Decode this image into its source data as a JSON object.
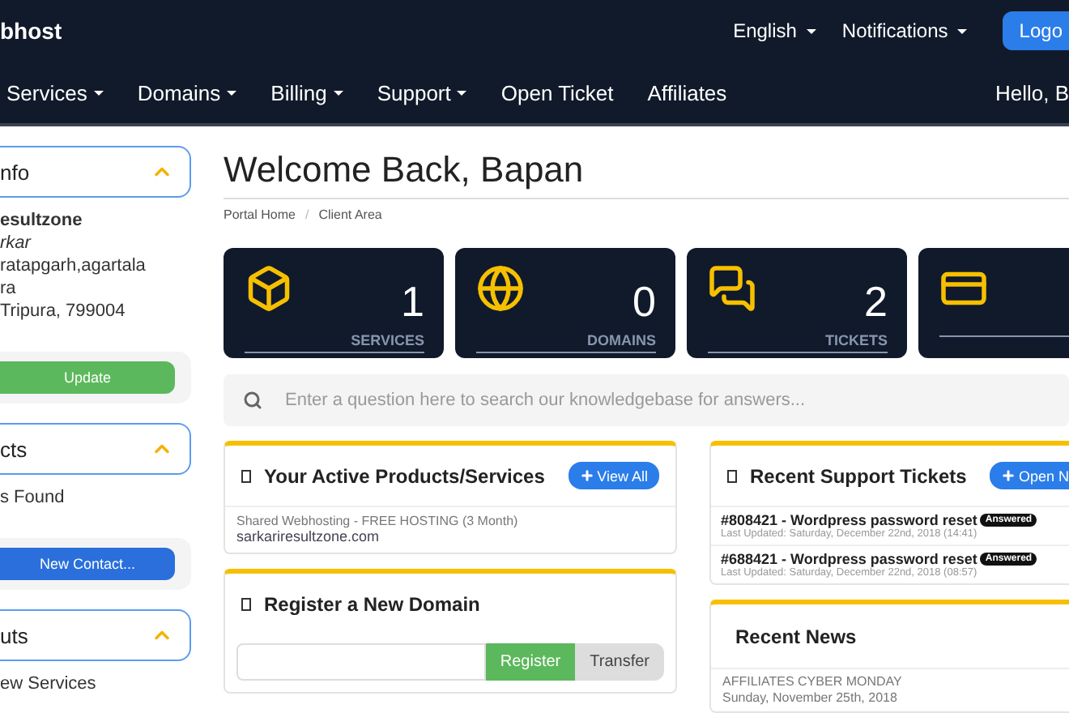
{
  "header": {
    "logo": "bhost",
    "menus": [
      {
        "label": "English"
      },
      {
        "label": "Notifications"
      }
    ],
    "logout_button": "Logo"
  },
  "nav": {
    "items": [
      {
        "label": "Services",
        "dropdown": true
      },
      {
        "label": "Domains",
        "dropdown": true
      },
      {
        "label": "Billing",
        "dropdown": true
      },
      {
        "label": "Support",
        "dropdown": true
      },
      {
        "label": "Open Ticket",
        "dropdown": false
      },
      {
        "label": "Affiliates",
        "dropdown": false
      }
    ],
    "greeting": "Hello, B"
  },
  "sidebar": {
    "panels": [
      {
        "title": "nfo",
        "expanded": true,
        "lines": [
          {
            "text": "esultzone",
            "kind": "name"
          },
          {
            "text": "rkar",
            "kind": "company"
          },
          {
            "text": "ratapgarh,agartala",
            "kind": "address"
          },
          {
            "text": "ra",
            "kind": "address"
          },
          {
            "text": "Tripura, 799004",
            "kind": "address"
          }
        ],
        "button": {
          "label": "Update",
          "kind": "success"
        }
      },
      {
        "title": "cts",
        "expanded": true,
        "lines": [
          {
            "text": "s Found",
            "kind": "address"
          }
        ],
        "button": {
          "label": "New Contact...",
          "kind": "primary"
        }
      },
      {
        "title": "uts",
        "expanded": true,
        "lines": [
          {
            "text": "ew Services",
            "kind": "address"
          }
        ]
      }
    ]
  },
  "main": {
    "title": "Welcome Back, Bapan",
    "breadcrumb": {
      "separator": "/",
      "items": [
        {
          "label": "Portal Home"
        },
        {
          "label": "Client Area"
        }
      ]
    },
    "stats": [
      {
        "kind": "box",
        "value": "1",
        "label": "SERVICES"
      },
      {
        "kind": "globe",
        "value": "0",
        "label": "DOMAINS"
      },
      {
        "kind": "chat",
        "value": "2",
        "label": "TICKETS"
      },
      {
        "kind": "card"
      }
    ],
    "search": {
      "placeholder": "Enter a question here to search our knowledgebase for answers..."
    },
    "products_panel": {
      "title": "Your Active Products/Services",
      "button": "View All",
      "items": [
        {
          "name": "Shared Webhosting - FREE HOSTING (3 Month)",
          "domain": "sarkariresultzone.com"
        }
      ]
    },
    "domain_panel": {
      "title": "Register a New Domain",
      "buttons": [
        {
          "label": "Register",
          "kind": "success"
        },
        {
          "label": "Transfer",
          "kind": "default"
        }
      ]
    },
    "tickets_panel": {
      "title": "Recent Support Tickets",
      "button": "Open N",
      "tickets": [
        {
          "title": "#808421 - Wordpress password reset",
          "status": "Answered",
          "updated": "Last Updated: Saturday, December 22nd, 2018 (14:41)"
        },
        {
          "title": "#688421 - Wordpress password reset",
          "status": "Answered",
          "updated": "Last Updated: Saturday, December 22nd, 2018 (08:57)"
        }
      ]
    },
    "news_panel": {
      "title": "Recent News",
      "items": [
        {
          "title": "AFFILIATES CYBER MONDAY",
          "date": "Sunday, November 25th, 2018"
        }
      ]
    }
  }
}
